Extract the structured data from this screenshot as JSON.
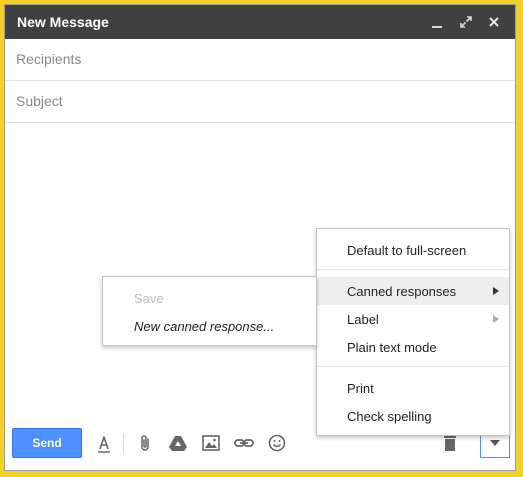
{
  "window": {
    "title": "New Message",
    "minimize_icon": "minimize-icon",
    "expand_icon": "expand-icon",
    "close_icon": "close-icon"
  },
  "fields": {
    "recipients_placeholder": "Recipients",
    "subject_placeholder": "Subject"
  },
  "toolbar": {
    "send_label": "Send",
    "icons": [
      "format-text-icon",
      "attach-icon",
      "drive-icon",
      "photo-icon",
      "link-icon",
      "emoji-icon",
      "trash-icon",
      "more-options-icon"
    ]
  },
  "more_menu": {
    "items": [
      {
        "label": "Default to full-screen"
      },
      {
        "label": "Canned responses",
        "has_submenu": true,
        "highlighted": true
      },
      {
        "label": "Label",
        "has_submenu": true
      },
      {
        "label": "Plain text mode"
      },
      {
        "label": "Print"
      },
      {
        "label": "Check spelling"
      }
    ]
  },
  "canned_submenu": {
    "save_label": "Save",
    "new_label": "New canned response..."
  },
  "colors": {
    "frame": "#f2d02a",
    "titlebar": "#404040",
    "send_button": "#4d90fe",
    "highlight": "#eeeeee"
  }
}
